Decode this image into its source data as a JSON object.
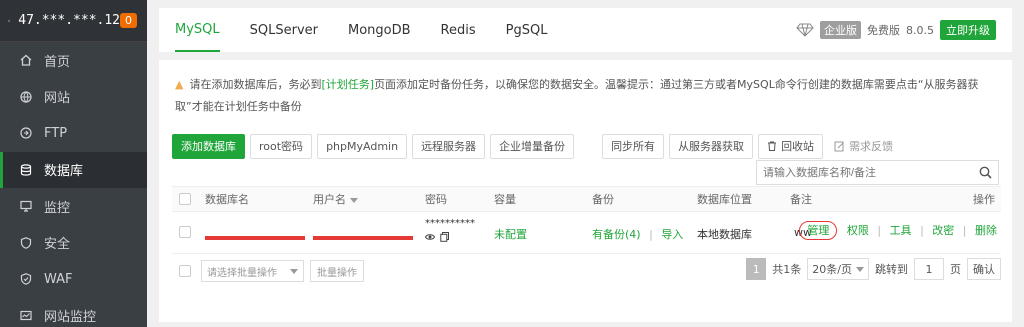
{
  "server": {
    "ip": "47.***.***.12",
    "badge": "0"
  },
  "sidebar": {
    "items": [
      {
        "label": "首页",
        "icon": "home-icon"
      },
      {
        "label": "网站",
        "icon": "globe-icon"
      },
      {
        "label": "FTP",
        "icon": "ftp-icon"
      },
      {
        "label": "数据库",
        "icon": "database-icon",
        "active": true
      },
      {
        "label": "监控",
        "icon": "monitor-icon"
      },
      {
        "label": "安全",
        "icon": "shield-icon"
      },
      {
        "label": "WAF",
        "icon": "waf-icon"
      },
      {
        "label": "网站监控",
        "icon": "site-monitor-icon"
      }
    ]
  },
  "tabs": [
    "MySQL",
    "SQLServer",
    "MongoDB",
    "Redis",
    "PgSQL"
  ],
  "top_right": {
    "edition_tag": "企业版",
    "free_label": "免费版",
    "version": "8.0.5",
    "upgrade": "立即升级"
  },
  "notice": {
    "part1": "请在添加数据库后，务必到",
    "link": "[计划任务]",
    "part2": "页面添加定时备份任务，以确保您的数据安全。温馨提示：通过第三方或者MySQL命令行创建的数据库需要点击“从服务器获取”才能在计划任务中备份"
  },
  "toolbar": {
    "add_db": "添加数据库",
    "root_pwd": "root密码",
    "phpmyadmin": "phpMyAdmin",
    "remote": "远程服务器",
    "enterprise_backup": "企业增量备份",
    "sync_all": "同步所有",
    "fetch_server": "从服务器获取",
    "recycle": "回收站",
    "feedback": "需求反馈"
  },
  "search": {
    "placeholder": "请输入数据库名称/备注"
  },
  "table": {
    "headers": {
      "db_name": "数据库名",
      "username": "用户名",
      "password": "密码",
      "capacity": "容量",
      "backup": "备份",
      "location": "数据库位置",
      "remark": "备注",
      "actions": "操作"
    },
    "row": {
      "password": "**********",
      "capacity": "未配置",
      "backup_count": "有备份(4)",
      "backup_sep": "|",
      "import": "导入",
      "location": "本地数据库",
      "remark": "ww",
      "actions": [
        "管理",
        "权限",
        "工具",
        "改密",
        "删除"
      ]
    }
  },
  "footer": {
    "batch_placeholder": "请选择批量操作",
    "batch_button": "批量操作",
    "page": "1",
    "total": "共1条",
    "page_size": "20条/页",
    "jump_label": "跳转到",
    "jump_value": "1",
    "page_unit": "页",
    "confirm": "确认"
  },
  "colors": {
    "accent": "#20a53a",
    "sidebar": "#3a3f44",
    "highlight": "#e53935"
  }
}
